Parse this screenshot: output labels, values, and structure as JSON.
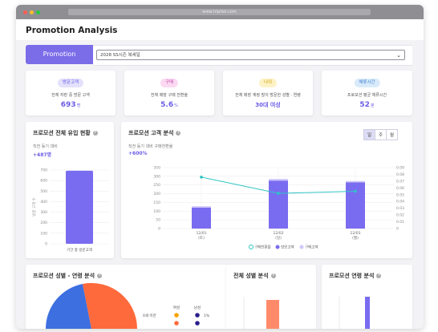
{
  "browser": {
    "url": "www.tripliwi.com"
  },
  "page": {
    "title": "Promotion Analysis"
  },
  "filter": {
    "promo_label": "Promotion",
    "selected": "2028 SS시즌 복세일"
  },
  "kpis": [
    {
      "badge": "방문고객",
      "label": "전체 자판 중 방문 고객",
      "value": "693",
      "unit": "명",
      "badge_bg": "#e3e1fb",
      "badge_fg": "#6b5ce6"
    },
    {
      "badge": "구매",
      "label": "전체 매장 구매 전환율",
      "value": "5.6",
      "unit": "%",
      "badge_bg": "#fbd9f3",
      "badge_fg": "#c44aa6"
    },
    {
      "badge": "나이",
      "label": "전체 매장 계정 많이 방문한 성별 · 연령",
      "value": "30대 여성",
      "unit": "",
      "badge_bg": "#fdf2c4",
      "badge_fg": "#c79a00"
    },
    {
      "badge": "체류시간",
      "label": "프로모션 평균 체류시간",
      "value": "52",
      "unit": "분",
      "badge_bg": "#d9ebfb",
      "badge_fg": "#3b7ecf"
    }
  ],
  "inflow": {
    "title": "프로모션 전체 유입 현황",
    "compare_label": "직전 동기 대비",
    "change": "+487명",
    "ylabel": "방문 고객 수",
    "yticks": [
      "700",
      "600",
      "500",
      "400",
      "300",
      "200",
      "100",
      "0"
    ],
    "xlabel": "기간 총 방문고객"
  },
  "customer": {
    "title": "프로모션 고객 분석",
    "compare_label": "직전 동기 대비 구매전환율",
    "change": "+600%",
    "tabs": [
      "일",
      "주",
      "월"
    ],
    "x_labels": [
      "12/01",
      "12/02",
      "12/03"
    ],
    "x_sub": [
      "(토)",
      "(일)",
      "(월)"
    ],
    "left_ticks": [
      "350",
      "300",
      "250",
      "200",
      "150",
      "100",
      "50",
      "0"
    ],
    "right_ticks": [
      "0.09",
      "0.08",
      "0.07",
      "0.06",
      "0.05",
      "0.04",
      "0.03",
      "0.02",
      "0.01",
      "0"
    ],
    "legend": [
      "구매전환율",
      "방문고객",
      "구매고객"
    ]
  },
  "chart_data": {
    "type": "bar",
    "categories": [
      "12/01 (토)",
      "12/02 (일)",
      "12/03 (월)"
    ],
    "series": [
      {
        "name": "방문고객",
        "type": "bar",
        "values": [
          120,
          275,
          265
        ]
      },
      {
        "name": "구매고객",
        "type": "bar",
        "values": [
          8,
          10,
          8
        ]
      },
      {
        "name": "구매전환율",
        "type": "line",
        "axis": "right",
        "values": [
          0.076,
          0.052,
          0.055
        ]
      }
    ],
    "ylim": [
      0,
      350
    ],
    "y2lim": [
      0,
      0.09
    ],
    "legend": "bottom"
  },
  "bottom": {
    "gender_age_title": "프로모션 성별 - 연령 분석",
    "gender_title": "전체 성별 분석",
    "age_title": "프로모션 연령 분석",
    "legend_head": [
      "여성",
      "남성"
    ],
    "legend_row": "0세 미만",
    "legend_pct": "1%"
  },
  "colors": {
    "accent": "#7b6ce8",
    "bar": "#7a6cf0",
    "bar_top": "#cfc8f8",
    "line": "#2ec4c4",
    "pie_blue": "#3d6fe0",
    "pie_orange": "#ff6a3d",
    "gender_bar": "#ff8a6a"
  }
}
